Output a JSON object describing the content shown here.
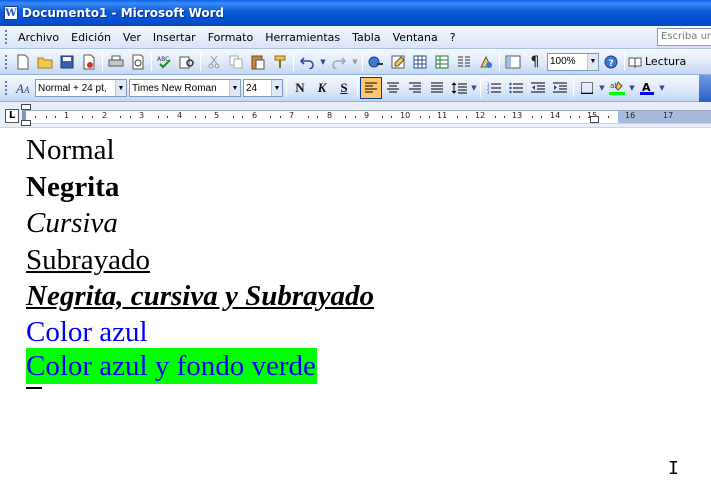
{
  "window": {
    "title": "Documento1 - Microsoft Word",
    "app_icon_letter": "W"
  },
  "menu": {
    "items": [
      "Archivo",
      "Edición",
      "Ver",
      "Insertar",
      "Formato",
      "Herramientas",
      "Tabla",
      "Ventana",
      "?"
    ],
    "help_placeholder": "Escriba una pregunta"
  },
  "standard_toolbar": {
    "zoom": "100%",
    "reading_label": "Lectura"
  },
  "format_toolbar": {
    "style": "Normal + 24 pt,",
    "font": "Times New Roman",
    "size": "24",
    "bold_label": "N",
    "italic_label": "K",
    "shadow_label": "S",
    "highlight_color": "#00ff00",
    "font_color": "#0000ff"
  },
  "ruler": {
    "numbers": [
      "1",
      "2",
      "3",
      "4",
      "5",
      "6",
      "7",
      "8",
      "9",
      "10",
      "11",
      "12",
      "13",
      "14",
      "15",
      "16",
      "17"
    ]
  },
  "document": {
    "lines": {
      "normal": "Normal",
      "bold": "Negrita",
      "italic": "Cursiva",
      "underline": "Subrayado",
      "combined": "Negrita, cursiva y Subrayado",
      "blue": "Color azul",
      "blue_green": "Color azul y fondo verde"
    },
    "colors": {
      "blue": "#0000ff",
      "green_background": "#00ff00"
    }
  }
}
